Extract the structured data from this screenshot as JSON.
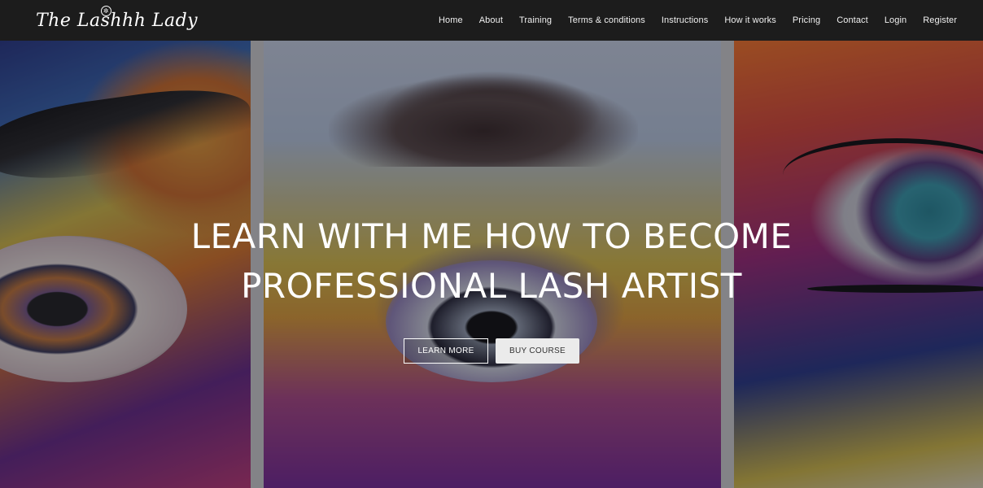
{
  "header": {
    "logo_text": "The Lashhh Lady",
    "nav": [
      {
        "label": "Home"
      },
      {
        "label": "About"
      },
      {
        "label": "Training"
      },
      {
        "label": "Terms & conditions"
      },
      {
        "label": "Instructions"
      },
      {
        "label": "How it works"
      },
      {
        "label": "Pricing"
      },
      {
        "label": "Contact"
      },
      {
        "label": "Login"
      },
      {
        "label": "Register"
      }
    ]
  },
  "hero": {
    "headline_line1": "LEARN WITH ME HOW TO BECOME",
    "headline_line2": "PROFESSIONAL LASH ARTIST",
    "learn_more_label": "LEARN MORE",
    "buy_course_label": "BUY COURSE"
  },
  "colors": {
    "header_bg": "#1c1c1c",
    "text_white": "#ffffff",
    "button_solid_bg": "#ebebeb",
    "button_solid_text": "#333333"
  }
}
